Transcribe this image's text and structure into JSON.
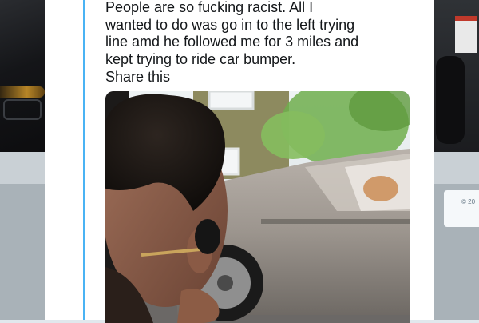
{
  "tweet": {
    "lines": [
      "People are so fucking racist. All I",
      "wanted to do was go in to the left trying",
      "line amd he followed me for 3 miles and",
      "kept trying to ride car bumper."
    ],
    "share_label": "Share this"
  },
  "background": {
    "footer_fragment": "© 20"
  },
  "colors": {
    "accent": "#4ab3f4",
    "text": "#14171a",
    "overlay": "#e1e8ed"
  },
  "icons": {
    "media": "video-thumbnail"
  }
}
